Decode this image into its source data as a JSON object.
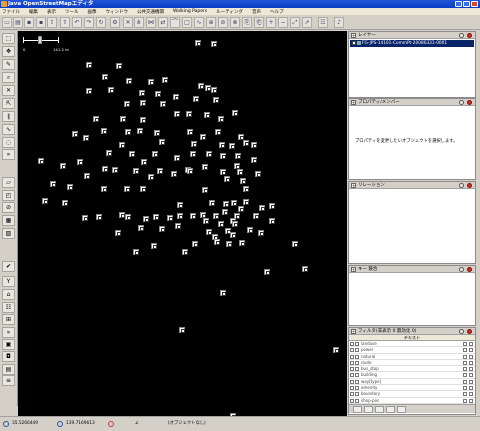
{
  "window": {
    "title": "Java OpenStreetMapエディタ"
  },
  "menu": [
    "ファイル",
    "編集",
    "表示",
    "ツール",
    "画像",
    "ウィンドウ",
    "公共交通機関",
    "Walking Papers",
    "ルーティング",
    "音声",
    "ヘルプ"
  ],
  "map": {
    "scale_start": "0",
    "scale_end": "141.2 m"
  },
  "layers": {
    "title": "レイヤー",
    "items": [
      "FG-JPS-14101-CommPt-20080331-0001"
    ]
  },
  "properties": {
    "title": "プロパティ/メンバー",
    "hint": "プロパティを変更したいオブジェクトを選択します。"
  },
  "relations": {
    "title": "リレーション"
  },
  "conflict": {
    "title": "キー 競合"
  },
  "filter": {
    "title": "フィルタ(非表示 0 無効化 0)",
    "col_text": "テキスト",
    "items": [
      "landuse",
      "power",
      "natural",
      "route",
      "bus_stop",
      "building",
      "way[type]",
      "amenity",
      "boundary",
      "shop-pos"
    ]
  },
  "status": {
    "lat": "35.5266449",
    "lon": "139.7169613",
    "selection": "(オブジェクトなし)"
  }
}
